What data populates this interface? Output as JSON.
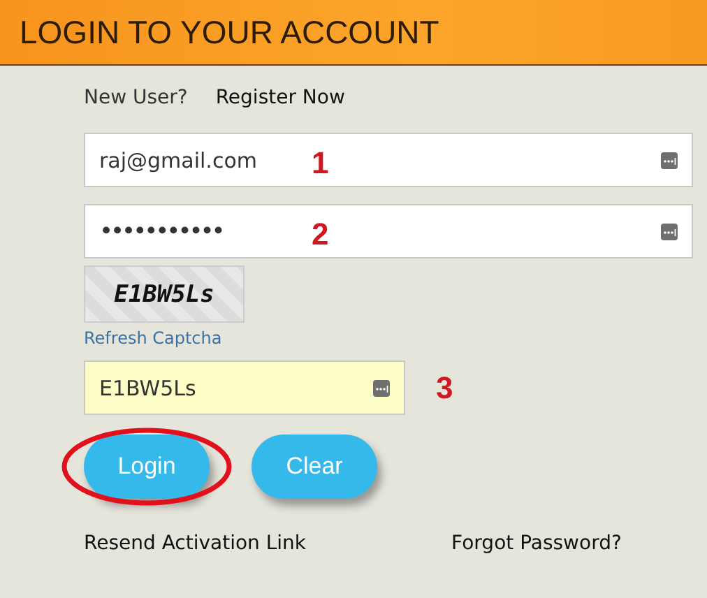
{
  "header": {
    "title": "LOGIN TO YOUR ACCOUNT"
  },
  "register": {
    "prompt": "New User?",
    "link": "Register Now"
  },
  "fields": [
    {
      "kind": "text",
      "value": "raj@gmail.com",
      "annotation": "1"
    },
    {
      "kind": "password",
      "value": "•••••••••••",
      "annotation": "2"
    }
  ],
  "captcha": {
    "image_text": "E1BW5Ls",
    "refresh": "Refresh Captcha",
    "value": "E1BW5Ls",
    "annotation": "3"
  },
  "buttons": [
    {
      "label": "Login",
      "circled": true
    },
    {
      "label": "Clear",
      "circled": false
    }
  ],
  "links": [
    "Resend Activation Link",
    "Forgot Password?"
  ]
}
